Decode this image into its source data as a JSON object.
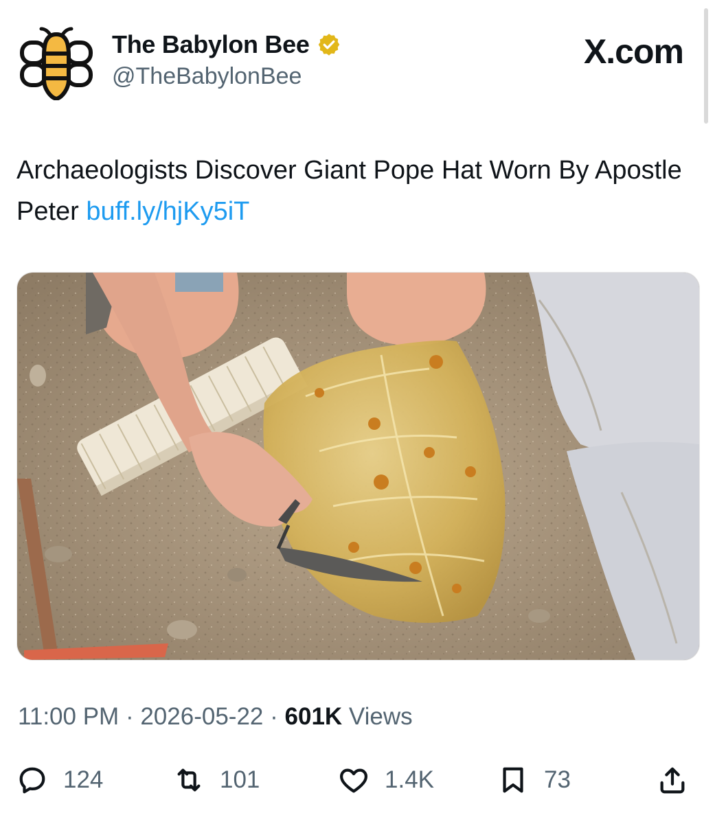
{
  "account": {
    "display_name": "The Babylon Bee",
    "handle": "@TheBabylonBee",
    "avatar_icon": "bee-logo-icon",
    "verified_icon": "verified-badge-icon",
    "verified_color": "#e2b719"
  },
  "brand": {
    "label": "X.com"
  },
  "tweet": {
    "text": "Archaeologists Discover Giant Pope Hat Worn By Apostle Peter",
    "link": "buff.ly/hjKy5iT",
    "link_color": "#1d9bf0"
  },
  "media": {
    "description_icon": "photo-archaeology-dig"
  },
  "meta": {
    "time": "11:00 PM",
    "separator": "·",
    "date": "2026-05-22",
    "views_count": "601K",
    "views_label": "Views"
  },
  "actions": {
    "replies": {
      "icon": "reply-icon",
      "count": "124"
    },
    "reposts": {
      "icon": "repost-icon",
      "count": "101"
    },
    "likes": {
      "icon": "heart-icon",
      "count": "1.4K"
    },
    "bookmarks": {
      "icon": "bookmark-icon",
      "count": "73"
    },
    "share": {
      "icon": "share-icon"
    }
  },
  "colors": {
    "text": "#0f1419",
    "muted": "#536471"
  }
}
